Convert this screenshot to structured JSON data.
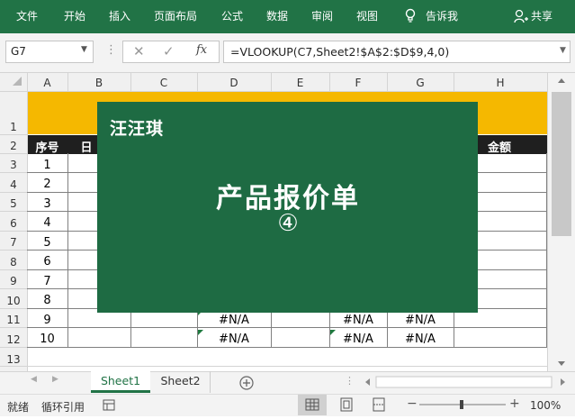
{
  "ribbon": {
    "menu": [
      "文件",
      "开始",
      "插入",
      "页面布局",
      "公式",
      "数据",
      "审阅",
      "视图"
    ],
    "tell_me": "告诉我",
    "share": "共享"
  },
  "formula": {
    "name_box": "G7",
    "function_label": "fx",
    "text": "=VLOOKUP(C7,Sheet2!$A$2:$D$9,4,0)"
  },
  "columns": [
    "A",
    "B",
    "C",
    "D",
    "E",
    "F",
    "G",
    "H"
  ],
  "rows": [
    "1",
    "2",
    "3",
    "4",
    "5",
    "6",
    "7",
    "8",
    "9",
    "10",
    "11",
    "12",
    "13"
  ],
  "table": {
    "header_seq": "序号",
    "header_date_partial": "日",
    "header_amount": "金额",
    "seq": [
      "1",
      "2",
      "3",
      "4",
      "5",
      "6",
      "7",
      "8",
      "9",
      "10"
    ],
    "na_d": [
      "#N/A",
      "#N/A"
    ],
    "na_f": [
      "#N/A",
      "#N/A"
    ],
    "na_g": [
      "#N/A",
      "#N/A"
    ]
  },
  "overlay": {
    "logo": "汪汪琪",
    "title": "产品报价单",
    "number": "④"
  },
  "sheets": [
    "Sheet1",
    "Sheet2"
  ],
  "active_sheet": "Sheet1",
  "status": {
    "ready": "就绪",
    "circular": "循环引用",
    "zoom": "100%"
  },
  "colors": {
    "ribbon": "#217346",
    "header_band": "#f5b800",
    "header_row": "#1f1f1f",
    "overlay": "#1e6b43"
  }
}
